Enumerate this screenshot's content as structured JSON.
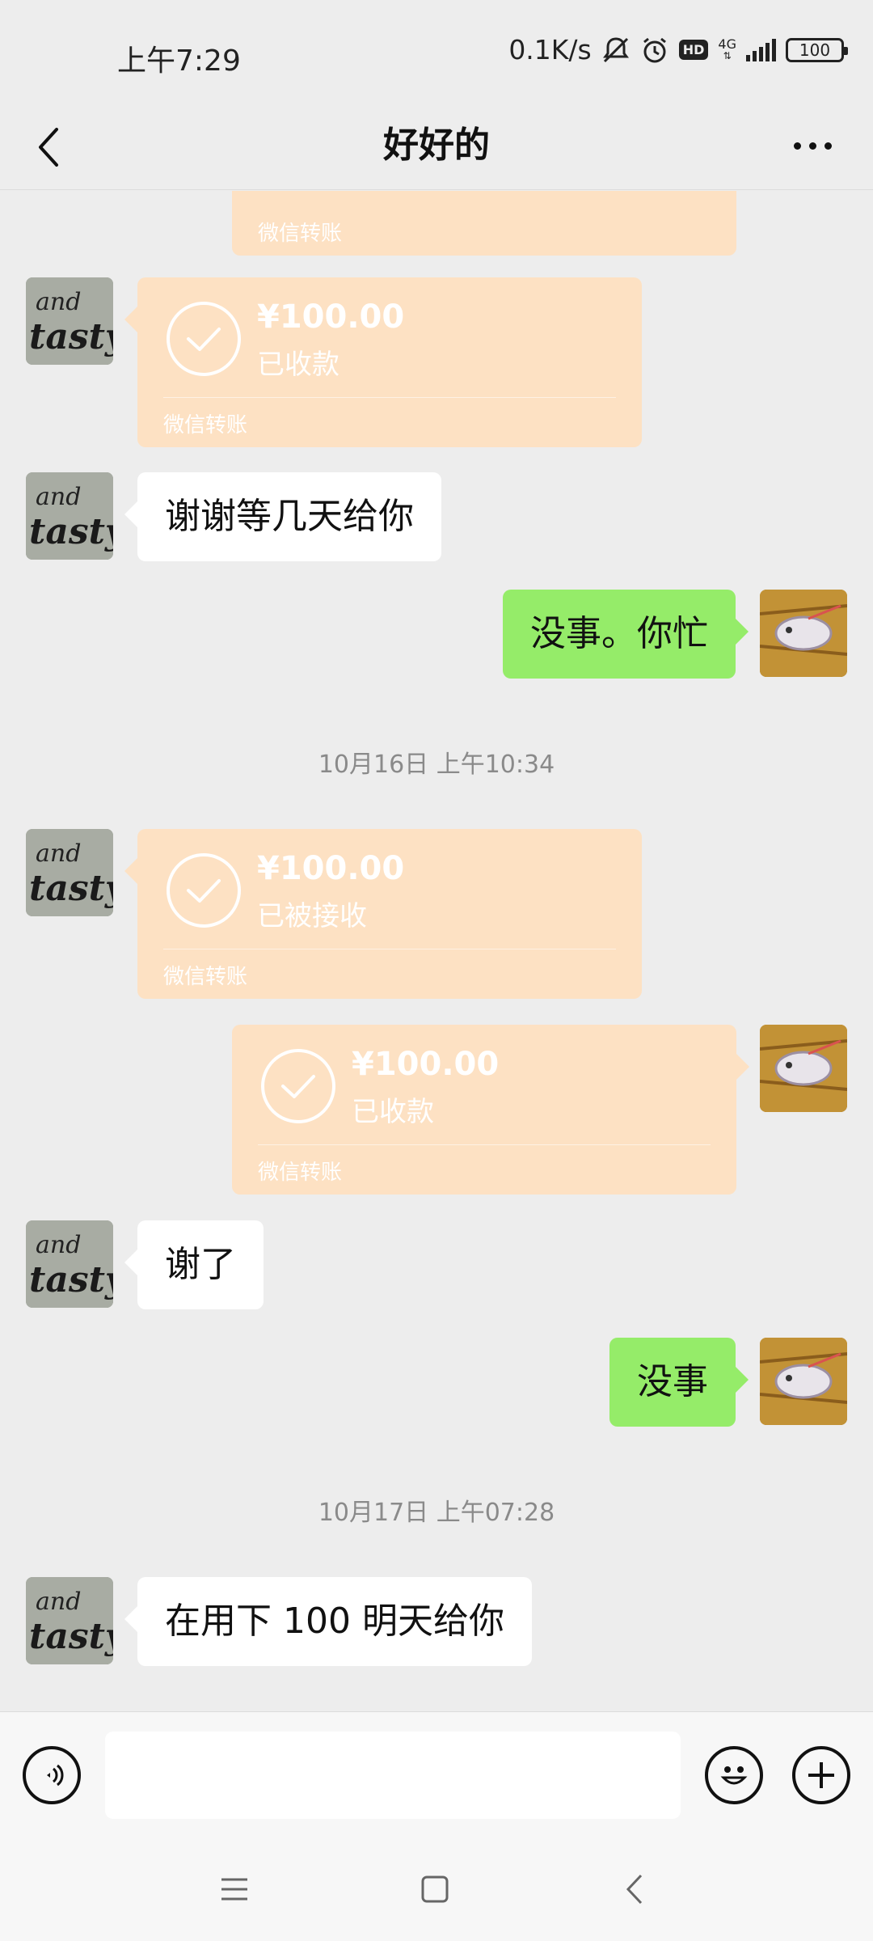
{
  "status_bar": {
    "time": "上午7:29",
    "net_speed": "0.1K/s",
    "hd_label": "HD",
    "network_label": "4G",
    "battery_level": "100",
    "icons": [
      "mute-bell-icon",
      "alarm-icon",
      "hd-icon",
      "signal-icon",
      "battery-icon"
    ]
  },
  "header": {
    "title": "好好的",
    "back_icon": "chevron-left-icon",
    "more_icon": "more-dots-icon"
  },
  "messages": {
    "partial_top": {
      "label": "微信转账"
    },
    "m1": {
      "amount": "¥100.00",
      "status": "已收款",
      "label": "微信转账"
    },
    "m2": {
      "text": "谢谢等几天给你"
    },
    "m3": {
      "text": "没事。你忙"
    },
    "ts1": {
      "text": "10月16日 上午10:34"
    },
    "m4": {
      "amount": "¥100.00",
      "status": "已被接收",
      "label": "微信转账"
    },
    "m5": {
      "amount": "¥100.00",
      "status": "已收款",
      "label": "微信转账"
    },
    "m6": {
      "text": "谢了"
    },
    "m7": {
      "text": "没事"
    },
    "ts2": {
      "text": "10月17日 上午07:28"
    },
    "m8": {
      "text": "在用下 100 明天给你"
    }
  },
  "input_bar": {
    "placeholder": "",
    "voice_icon": "voice-icon",
    "emoji_icon": "emoji-icon",
    "plus_icon": "plus-icon"
  },
  "system_nav": {
    "icons": [
      "menu-icon",
      "home-icon",
      "back-icon"
    ]
  },
  "colors": {
    "background": "#ededed",
    "self_bubble": "#95ec69",
    "other_bubble": "#ffffff",
    "transfer_card": "#fde1c3"
  }
}
